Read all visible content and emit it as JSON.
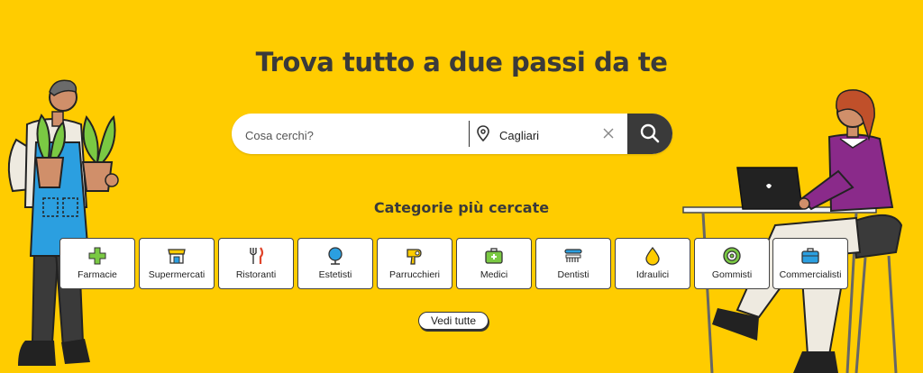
{
  "hero": {
    "title": "Trova tutto a due passi da te",
    "subtitle": "Categorie più cercate"
  },
  "search": {
    "query_placeholder": "Cosa cerchi?",
    "query_value": "",
    "location_value": "Cagliari",
    "location_icon": "map-pin-icon",
    "clear_icon": "close-icon",
    "submit_icon": "search-icon"
  },
  "categories": [
    {
      "label": "Farmacie",
      "icon": "pharmacy-cross-icon"
    },
    {
      "label": "Supermercati",
      "icon": "store-icon"
    },
    {
      "label": "Ristoranti",
      "icon": "fork-knife-icon"
    },
    {
      "label": "Estetisti",
      "icon": "mirror-icon"
    },
    {
      "label": "Parrucchieri",
      "icon": "hair-dryer-icon"
    },
    {
      "label": "Medici",
      "icon": "medical-bag-icon"
    },
    {
      "label": "Dentisti",
      "icon": "toothbrush-icon"
    },
    {
      "label": "Idraulici",
      "icon": "water-drop-icon"
    },
    {
      "label": "Gommisti",
      "icon": "tire-icon"
    },
    {
      "label": "Commercialisti",
      "icon": "briefcase-icon"
    }
  ],
  "see_all_label": "Vedi tutte",
  "colors": {
    "background": "#ffcc00",
    "text_dark": "#3a3a3a",
    "search_button": "#3a3a3a",
    "icon_green": "#7ac943",
    "icon_blue": "#2b9fe0"
  }
}
